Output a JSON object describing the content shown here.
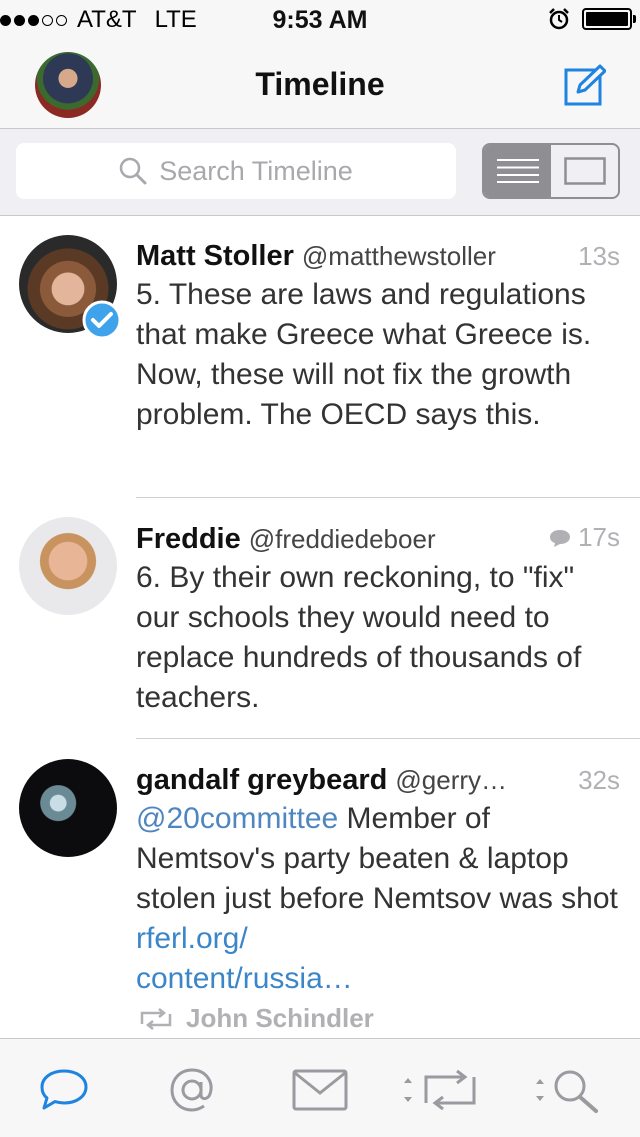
{
  "status_bar": {
    "carrier": "AT&T",
    "network": "LTE",
    "time": "9:53 AM",
    "signal_bars_filled": 3,
    "signal_bars_total": 5
  },
  "nav": {
    "title": "Timeline"
  },
  "search": {
    "placeholder": "Search Timeline"
  },
  "timeline": [
    {
      "name": "Matt Stoller",
      "handle": "@matthewstoller",
      "age": "13s",
      "verified": true,
      "text": "5. These are laws and regulations that make Greece what Greece is. Now, these will not fix the growth problem. The OECD says this."
    },
    {
      "name": "Freddie",
      "handle": "@freddiedeboer",
      "age": "17s",
      "has_reply_icon": true,
      "text": "6. By their own reckoning, to \"fix\" our schools they would need to replace hundreds of thousands of teachers."
    },
    {
      "name": "gandalf greybeard",
      "handle": "@gerry…",
      "age": "32s",
      "mention": "@20committee",
      "text": " Member of Nemtsov's party beaten & laptop stolen just before Nemtsov was shot ",
      "link": "rferl.org/\ncontent/russia…",
      "retweeted_by": "John Schindler"
    }
  ],
  "tab_bar": {
    "tabs": [
      "timeline-tab",
      "mentions-tab",
      "messages-tab",
      "activity-tab",
      "search-tab"
    ],
    "active": "timeline-tab"
  },
  "colors": {
    "accent": "#1f83e0",
    "link": "#3b86c8",
    "verified": "#3ea3ea"
  }
}
